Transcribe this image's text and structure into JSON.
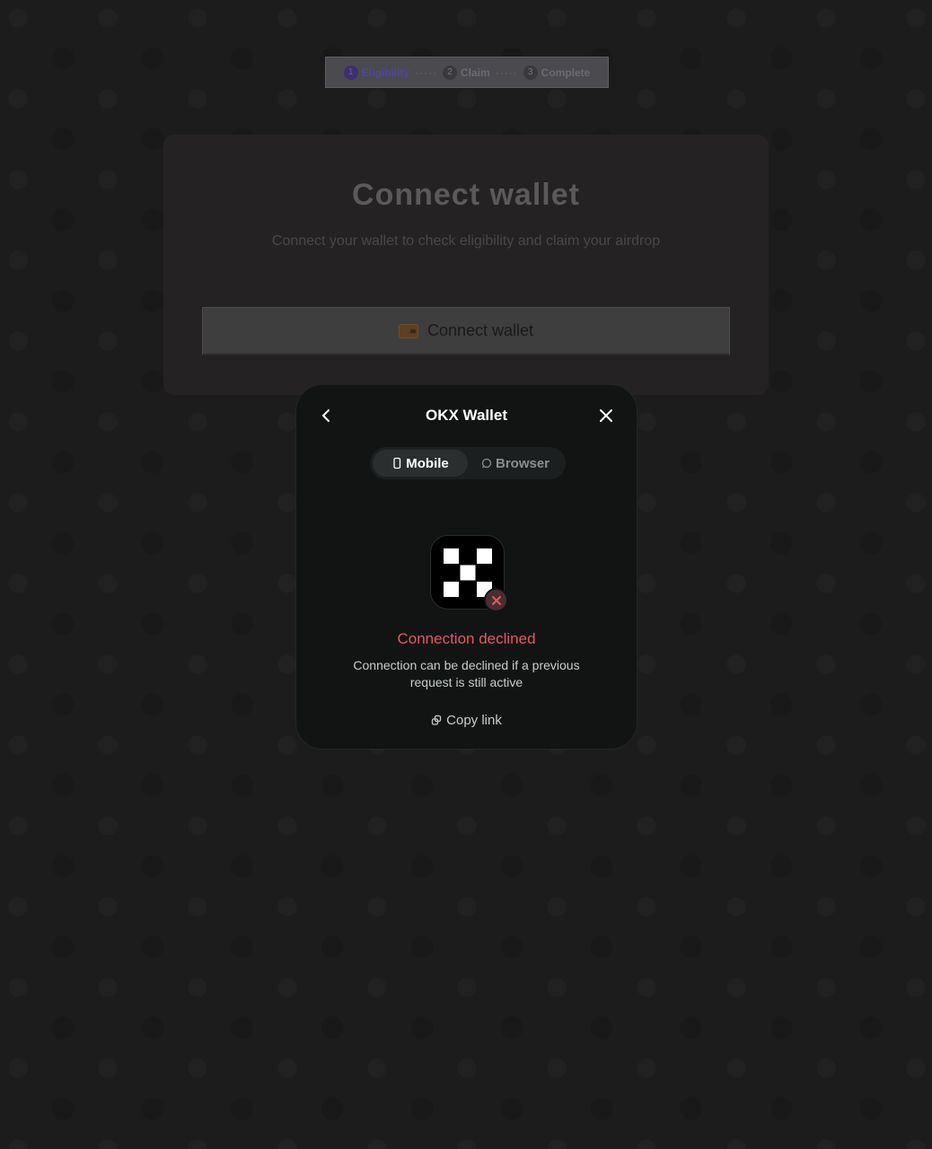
{
  "stepper": {
    "steps": [
      {
        "num": "1",
        "label": "Eligibility"
      },
      {
        "num": "2",
        "label": "Claim"
      },
      {
        "num": "3",
        "label": "Complete"
      }
    ],
    "separator": "·····"
  },
  "card": {
    "title": "Connect wallet",
    "subtitle": "Connect your wallet to check eligibility and claim your airdrop",
    "button_label": "Connect wallet"
  },
  "modal": {
    "title": "OKX Wallet",
    "tabs": [
      {
        "label": "Mobile",
        "icon": "phone-icon",
        "selected": true
      },
      {
        "label": "Browser",
        "icon": "globe-icon",
        "selected": false
      }
    ],
    "status_title": "Connection declined",
    "status_description": "Connection can be declined if a previous request is still active",
    "copy_link_label": "Copy link"
  },
  "colors": {
    "error": "#e5575e",
    "modal_bg": "#121414",
    "accent": "#4f45a0"
  }
}
